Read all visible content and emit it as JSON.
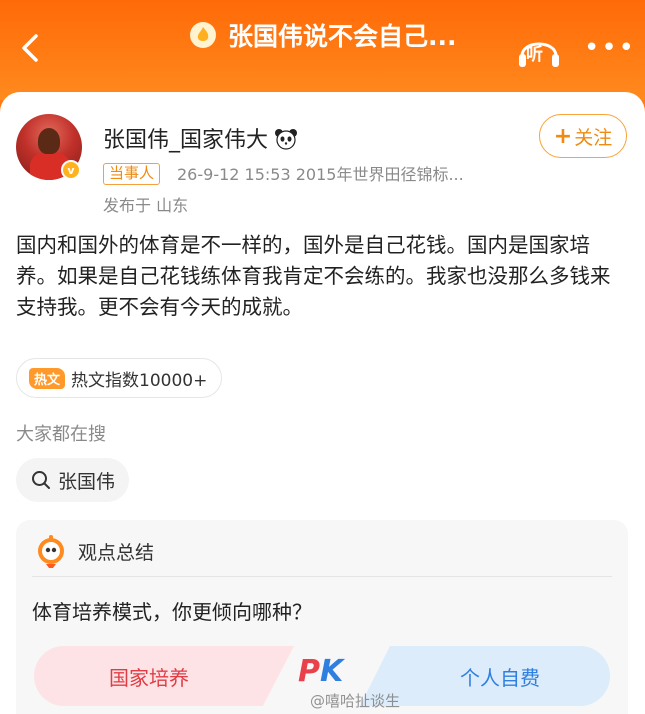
{
  "header": {
    "title": "张国伟说不会自己...",
    "listen_label": "听",
    "more": "•••"
  },
  "post": {
    "username": "张国伟_国家伟大",
    "follow_label": "关注",
    "tag": "当事人",
    "meta": "26-9-12 15:53  2015年世界田径锦标...",
    "location": "发布于 山东",
    "content": "国内和国外的体育是不一样的，国外是自己花钱。国内是国家培养。如果是自己花钱练体育我肯定不会练的。我家也没那么多钱来支持我。更不会有今天的成就。",
    "hot_badge": "热文",
    "hot_index": "热文指数10000+"
  },
  "search": {
    "label": "大家都在搜",
    "chip": "张国伟"
  },
  "summary": {
    "title": "观点总结",
    "question": "体育培养模式，你更倾向哪种？",
    "option_left": "国家培养",
    "option_right": "个人自费",
    "pk_p": "P",
    "pk_k": "K"
  },
  "watermark": "@嘻哈扯谈生"
}
